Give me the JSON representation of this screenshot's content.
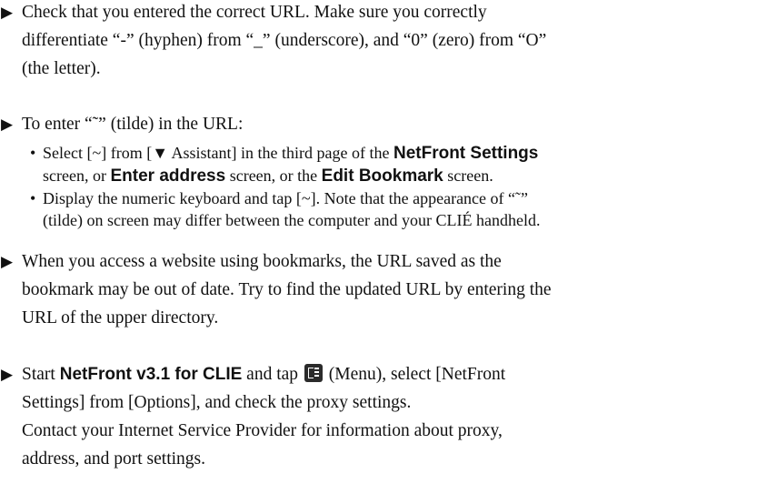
{
  "bullet_glyph": "▶",
  "sub_bullet_glyph": "•",
  "item1": {
    "line1": "Check that you entered the correct URL. Make sure you correctly",
    "line2": "differentiate “-” (hyphen) from “_” (underscore), and “0” (zero) from “O”",
    "line3": "(the letter)."
  },
  "item2": {
    "line1": "To enter “˜” (tilde) in the URL:",
    "sub1": {
      "a": "Select [~] from [▼ Assistant] in the third page of the ",
      "b_bold": "NetFront Settings",
      "c": "screen, or ",
      "d_bold": "Enter address",
      "e": " screen, or the ",
      "f_bold": "Edit Bookmark",
      "g": " screen."
    },
    "sub2": {
      "line1": "Display the numeric keyboard and tap [~]. Note that the appearance of “˜”",
      "line2": "(tilde) on screen may differ between the computer and your CLIÉ handheld."
    }
  },
  "item3": {
    "line1": "When you access a website using bookmarks, the URL saved as the",
    "line2": "bookmark may be out of date. Try to find the updated URL by entering the",
    "line3": "URL of the upper directory."
  },
  "item4": {
    "a": "Start ",
    "b_bold": "NetFront v3.1 for CLIE",
    "c": " and tap ",
    "menu_icon": "menu-icon",
    "d": " (Menu), select [NetFront",
    "line2": "Settings] from [Options], and check the proxy settings.",
    "line3": "Contact your Internet Service Provider for information about proxy,",
    "line4": "address, and port settings."
  }
}
